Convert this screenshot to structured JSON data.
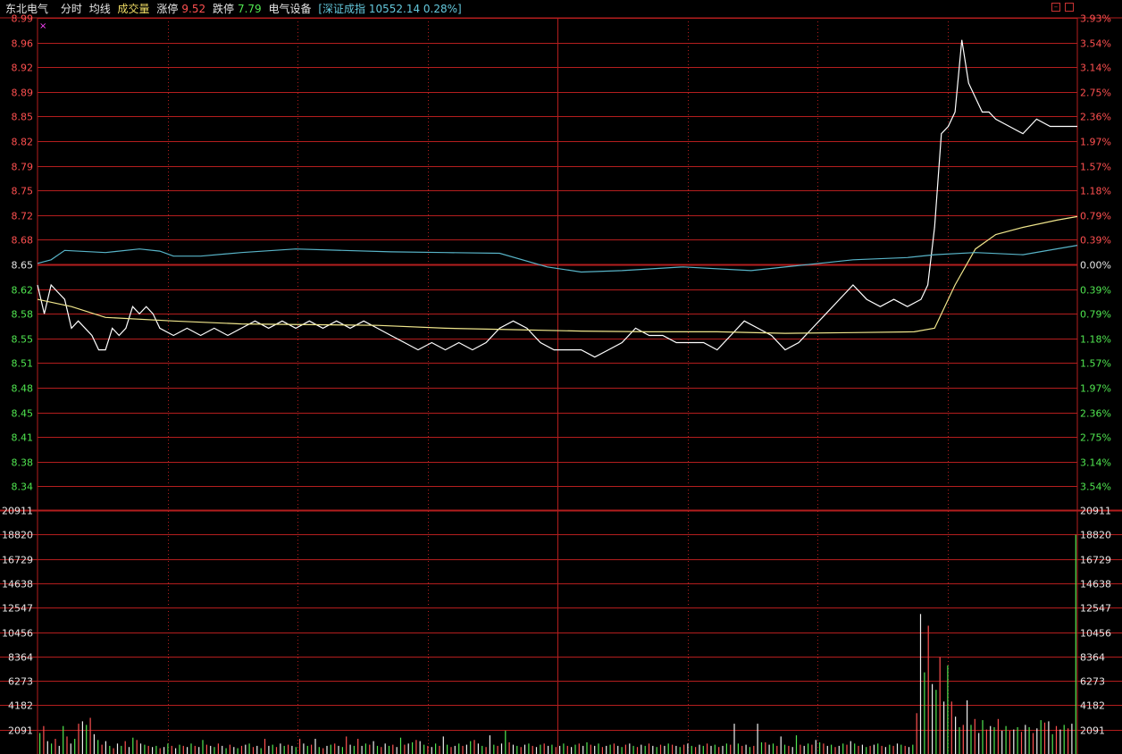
{
  "header": {
    "stock_name": "东北电气",
    "mode_tab": "分时",
    "avg_line_label": "均线",
    "volume_label": "成交量",
    "limit_up_label": "涨停",
    "limit_up_value": "9.52",
    "limit_down_label": "跌停",
    "limit_down_value": "7.79",
    "sector": "电气设备",
    "index_info": "[深证成指 10552.14 0.28%]"
  },
  "colors": {
    "background": "#000000",
    "grid": "#b41e1e",
    "up": "#ff5050",
    "down": "#50e650",
    "price_line": "#ffffff",
    "avg_line": "#f0e68c",
    "index_line": "#58b4c8",
    "header_white": "#e6e6e6",
    "header_yellow": "#f0dc64",
    "header_cyan": "#64c8dc"
  },
  "chart_data": [
    {
      "type": "line",
      "name": "intraday-price",
      "prev_close": 8.65,
      "ylim": [
        8.32,
        9.0
      ],
      "y_ticks_left": [
        "8.99",
        "8.96",
        "8.92",
        "8.89",
        "8.85",
        "8.82",
        "8.79",
        "8.75",
        "8.72",
        "8.68",
        "8.65",
        "8.62",
        "8.58",
        "8.55",
        "8.51",
        "8.48",
        "8.45",
        "8.41",
        "8.38",
        "8.34"
      ],
      "y_ticks_right": [
        "3.93%",
        "3.54%",
        "3.14%",
        "2.75%",
        "2.36%",
        "1.97%",
        "1.57%",
        "1.18%",
        "0.79%",
        "0.39%",
        "0.00%",
        "0.39%",
        "0.79%",
        "1.18%",
        "1.57%",
        "1.97%",
        "2.36%",
        "2.75%",
        "3.14%",
        "3.54%"
      ],
      "x_range": [
        0,
        240
      ],
      "series": [
        {
          "values_xy": [
            [
              0,
              8.62
            ],
            [
              2,
              8.58
            ],
            [
              4,
              8.62
            ],
            [
              6,
              8.61
            ],
            [
              8,
              8.6
            ],
            [
              10,
              8.56
            ],
            [
              12,
              8.57
            ],
            [
              14,
              8.56
            ],
            [
              16,
              8.55
            ],
            [
              18,
              8.53
            ],
            [
              20,
              8.53
            ],
            [
              22,
              8.56
            ],
            [
              24,
              8.55
            ],
            [
              26,
              8.56
            ],
            [
              28,
              8.59
            ],
            [
              30,
              8.58
            ],
            [
              32,
              8.59
            ],
            [
              34,
              8.58
            ],
            [
              36,
              8.56
            ],
            [
              40,
              8.55
            ],
            [
              44,
              8.56
            ],
            [
              48,
              8.55
            ],
            [
              52,
              8.56
            ],
            [
              56,
              8.55
            ],
            [
              60,
              8.56
            ],
            [
              64,
              8.57
            ],
            [
              68,
              8.56
            ],
            [
              72,
              8.57
            ],
            [
              76,
              8.56
            ],
            [
              80,
              8.57
            ],
            [
              84,
              8.56
            ],
            [
              88,
              8.57
            ],
            [
              92,
              8.56
            ],
            [
              96,
              8.57
            ],
            [
              100,
              8.56
            ],
            [
              104,
              8.55
            ],
            [
              108,
              8.54
            ],
            [
              112,
              8.53
            ],
            [
              116,
              8.54
            ],
            [
              120,
              8.53
            ],
            [
              124,
              8.54
            ],
            [
              128,
              8.53
            ],
            [
              132,
              8.54
            ],
            [
              136,
              8.56
            ],
            [
              140,
              8.57
            ],
            [
              144,
              8.56
            ],
            [
              148,
              8.54
            ],
            [
              152,
              8.53
            ],
            [
              156,
              8.53
            ],
            [
              160,
              8.53
            ],
            [
              164,
              8.52
            ],
            [
              168,
              8.53
            ],
            [
              172,
              8.54
            ],
            [
              176,
              8.56
            ],
            [
              180,
              8.55
            ],
            [
              184,
              8.55
            ],
            [
              188,
              8.54
            ],
            [
              192,
              8.54
            ],
            [
              196,
              8.54
            ],
            [
              200,
              8.53
            ],
            [
              204,
              8.55
            ],
            [
              208,
              8.57
            ],
            [
              212,
              8.56
            ],
            [
              216,
              8.55
            ],
            [
              220,
              8.53
            ],
            [
              224,
              8.54
            ],
            [
              228,
              8.56
            ],
            [
              232,
              8.58
            ],
            [
              236,
              8.6
            ],
            [
              240,
              8.62
            ],
            [
              244,
              8.6
            ],
            [
              248,
              8.59
            ],
            [
              252,
              8.6
            ],
            [
              256,
              8.59
            ],
            [
              260,
              8.6
            ],
            [
              262,
              8.62
            ],
            [
              264,
              8.7
            ],
            [
              266,
              8.83
            ],
            [
              268,
              8.84
            ],
            [
              270,
              8.86
            ],
            [
              272,
              8.96
            ],
            [
              274,
              8.9
            ],
            [
              276,
              8.88
            ],
            [
              278,
              8.86
            ],
            [
              280,
              8.86
            ],
            [
              282,
              8.85
            ],
            [
              286,
              8.84
            ],
            [
              290,
              8.83
            ],
            [
              294,
              8.85
            ],
            [
              298,
              8.84
            ],
            [
              302,
              8.84
            ],
            [
              306,
              8.84
            ]
          ],
          "color_key": "price_line"
        },
        {
          "values_xy": [
            [
              0,
              8.6
            ],
            [
              10,
              8.59
            ],
            [
              20,
              8.575
            ],
            [
              40,
              8.57
            ],
            [
              60,
              8.566
            ],
            [
              80,
              8.565
            ],
            [
              100,
              8.564
            ],
            [
              120,
              8.56
            ],
            [
              140,
              8.558
            ],
            [
              160,
              8.556
            ],
            [
              180,
              8.555
            ],
            [
              200,
              8.555
            ],
            [
              220,
              8.553
            ],
            [
              240,
              8.554
            ],
            [
              258,
              8.555
            ],
            [
              264,
              8.56
            ],
            [
              270,
              8.62
            ],
            [
              276,
              8.67
            ],
            [
              282,
              8.69
            ],
            [
              290,
              8.7
            ],
            [
              300,
              8.71
            ],
            [
              306,
              8.715
            ]
          ],
          "color_key": "avg_line"
        },
        {
          "values_xy": [
            [
              0,
              8.65
            ],
            [
              4,
              8.655
            ],
            [
              8,
              8.668
            ],
            [
              20,
              8.665
            ],
            [
              30,
              8.67
            ],
            [
              36,
              8.667
            ],
            [
              40,
              8.66
            ],
            [
              48,
              8.66
            ],
            [
              60,
              8.665
            ],
            [
              76,
              8.67
            ],
            [
              90,
              8.668
            ],
            [
              104,
              8.666
            ],
            [
              120,
              8.665
            ],
            [
              136,
              8.664
            ],
            [
              150,
              8.645
            ],
            [
              160,
              8.638
            ],
            [
              172,
              8.64
            ],
            [
              190,
              8.645
            ],
            [
              210,
              8.64
            ],
            [
              230,
              8.65
            ],
            [
              240,
              8.655
            ],
            [
              256,
              8.658
            ],
            [
              264,
              8.662
            ],
            [
              276,
              8.665
            ],
            [
              290,
              8.662
            ],
            [
              306,
              8.675
            ]
          ],
          "color_key": "index_line"
        }
      ]
    },
    {
      "type": "bar",
      "name": "volume",
      "ylim": [
        0,
        20911
      ],
      "y_ticks": [
        "20911",
        "18820",
        "16729",
        "14638",
        "12547",
        "10456",
        "8364",
        "6273",
        "4182",
        "2091"
      ],
      "x_range": [
        0,
        240
      ],
      "values": [
        1800,
        2400,
        1100,
        900,
        1300,
        700,
        2400,
        1500,
        900,
        1300,
        2600,
        2800,
        2500,
        3100,
        1700,
        1200,
        800,
        1100,
        700,
        500,
        900,
        700,
        1100,
        600,
        1400,
        1200,
        900,
        800,
        700,
        600,
        700,
        500,
        600,
        900,
        700,
        500,
        800,
        700,
        600,
        900,
        700,
        600,
        1200,
        800,
        700,
        600,
        900,
        700,
        500,
        800,
        600,
        500,
        700,
        800,
        900,
        600,
        700,
        500,
        1300,
        700,
        800,
        600,
        900,
        700,
        800,
        700,
        600,
        1300,
        900,
        700,
        800,
        1300,
        600,
        500,
        700,
        800,
        900,
        700,
        600,
        1500,
        800,
        700,
        1300,
        700,
        900,
        800,
        1100,
        700,
        600,
        900,
        700,
        800,
        600,
        1400,
        800,
        900,
        1000,
        1200,
        1100,
        800,
        700,
        600,
        900,
        700,
        1500,
        800,
        600,
        700,
        900,
        700,
        800,
        1100,
        1200,
        900,
        700,
        600,
        1600,
        800,
        700,
        900,
        2000,
        1000,
        800,
        700,
        600,
        800,
        900,
        700,
        600,
        800,
        900,
        700,
        800,
        600,
        700,
        900,
        700,
        600,
        800,
        900,
        700,
        1000,
        800,
        700,
        900,
        600,
        700,
        800,
        900,
        700,
        600,
        800,
        900,
        700,
        600,
        800,
        700,
        900,
        700,
        600,
        800,
        700,
        900,
        800,
        700,
        600,
        800,
        900,
        700,
        600,
        800,
        700,
        900,
        700,
        800,
        600,
        700,
        900,
        800,
        2600,
        900,
        700,
        800,
        600,
        700,
        2600,
        1000,
        1000,
        800,
        900,
        700,
        1500,
        800,
        700,
        600,
        1600,
        800,
        700,
        900,
        800,
        1200,
        1000,
        900,
        700,
        800,
        600,
        700,
        900,
        800,
        1100,
        900,
        700,
        800,
        600,
        700,
        800,
        900,
        700,
        600,
        800,
        700,
        900,
        800,
        700,
        600,
        800,
        3500,
        12000,
        7000,
        11000,
        6000,
        5500,
        8300,
        4500,
        7600,
        4500,
        3200,
        2300,
        2500,
        4600,
        2500,
        3000,
        1800,
        2900,
        2100,
        2400,
        2300,
        3000,
        2000,
        2400,
        2000,
        2100,
        2300,
        1900,
        2500,
        2300,
        1800,
        2200,
        2900,
        2700,
        2800,
        1700,
        2400,
        2100,
        2500,
        2200,
        2600,
        18800
      ],
      "directions_note": ""
    }
  ]
}
